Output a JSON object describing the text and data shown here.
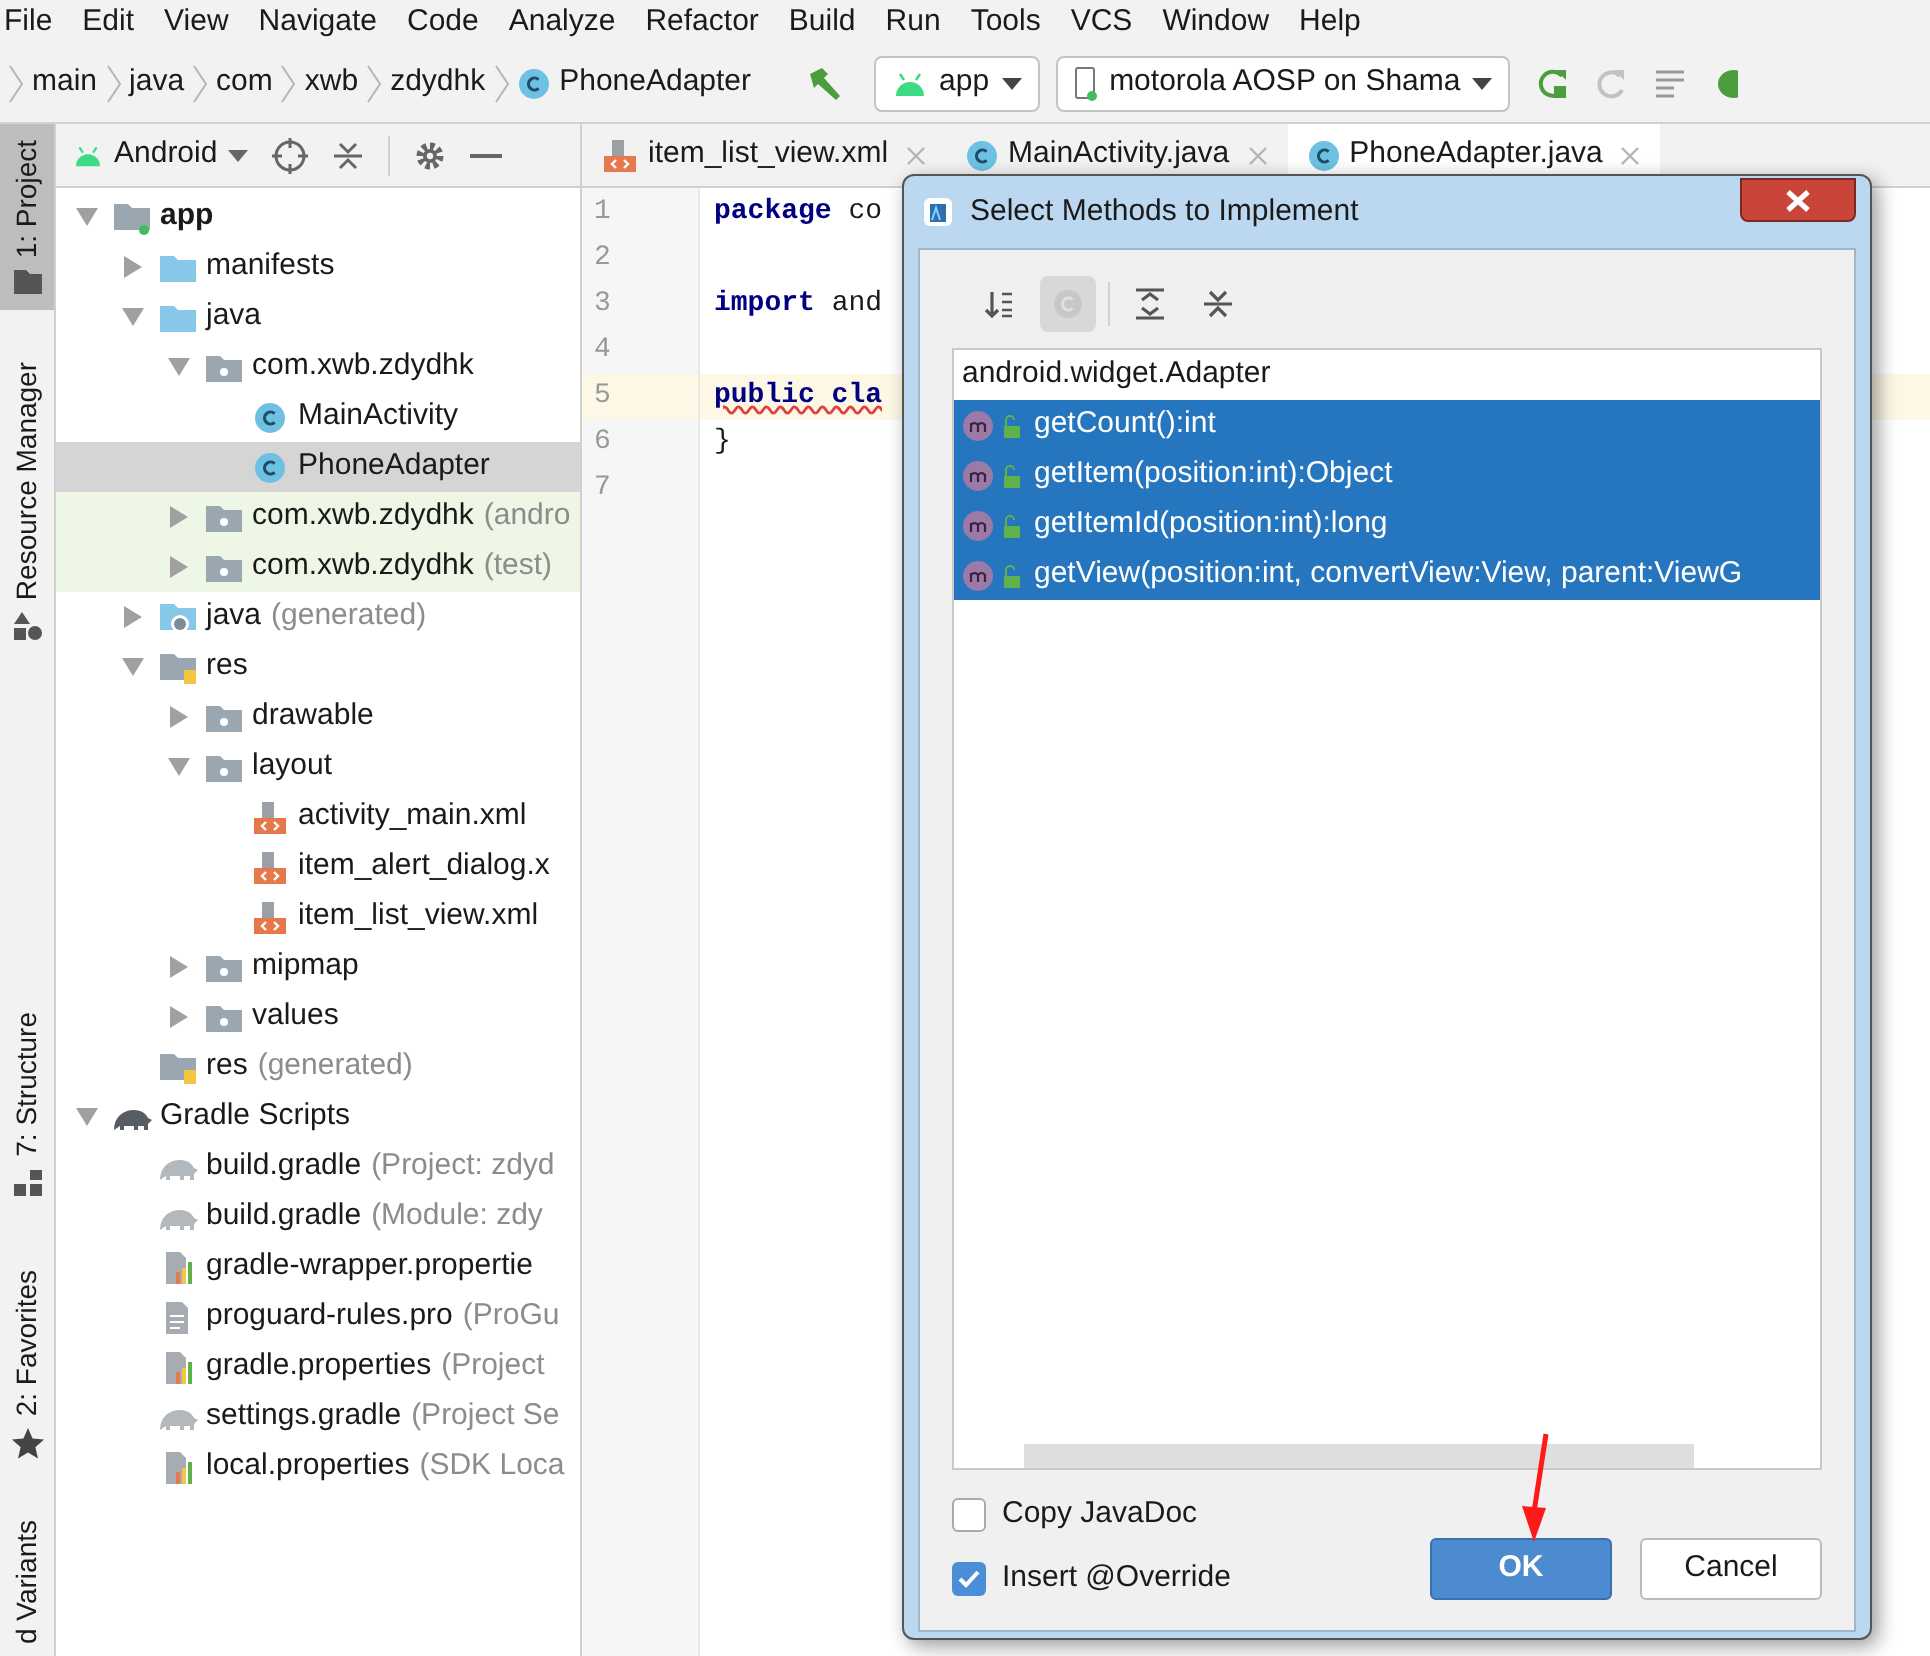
{
  "menu": [
    "File",
    "Edit",
    "View",
    "Navigate",
    "Code",
    "Analyze",
    "Refactor",
    "Build",
    "Run",
    "Tools",
    "VCS",
    "Window",
    "Help"
  ],
  "breadcrumb": [
    {
      "label": "main",
      "kind": "dir"
    },
    {
      "label": "java",
      "kind": "dir"
    },
    {
      "label": "com",
      "kind": "dir"
    },
    {
      "label": "xwb",
      "kind": "dir"
    },
    {
      "label": "zdydhk",
      "kind": "dir"
    },
    {
      "label": "PhoneAdapter",
      "kind": "class"
    }
  ],
  "run_config": "app",
  "device": "motorola AOSP on Shama",
  "side_tabs": [
    {
      "label": "1: Project",
      "selected": true,
      "kind": "folder"
    },
    {
      "label": "Resource Manager",
      "selected": false,
      "kind": "shapes"
    },
    {
      "label": "7: Structure",
      "selected": false,
      "kind": "blocks"
    },
    {
      "label": "2: Favorites",
      "selected": false,
      "kind": "star"
    },
    {
      "label": "d Variants",
      "selected": false,
      "kind": "none"
    }
  ],
  "project_view": "Android",
  "tree": [
    {
      "label": "app",
      "kind": "module",
      "expanded": true,
      "selected": false,
      "children": [
        {
          "label": "manifests",
          "kind": "folder",
          "expanded": false,
          "selected": false
        },
        {
          "label": "java",
          "kind": "folder",
          "expanded": true,
          "selected": false,
          "children": [
            {
              "label": "com.xwb.zdydhk",
              "kind": "package",
              "expanded": true,
              "selected": false,
              "children": [
                {
                  "label": "MainActivity",
                  "kind": "class",
                  "selected": false
                },
                {
                  "label": "PhoneAdapter",
                  "kind": "class",
                  "selected": true
                }
              ]
            },
            {
              "label": "com.xwb.zdydhk",
              "hint": "(andro",
              "kind": "package",
              "expanded": false,
              "selected": false,
              "tinted": true
            },
            {
              "label": "com.xwb.zdydhk",
              "hint": "(test)",
              "kind": "package",
              "expanded": false,
              "selected": false,
              "tinted": true
            }
          ]
        },
        {
          "label": "java",
          "hint": "(generated)",
          "kind": "gen-folder",
          "expanded": false,
          "selected": false
        },
        {
          "label": "res",
          "kind": "res-folder",
          "expanded": true,
          "selected": false,
          "children": [
            {
              "label": "drawable",
              "kind": "package",
              "expanded": false,
              "selected": false
            },
            {
              "label": "layout",
              "kind": "package",
              "expanded": true,
              "selected": false,
              "children": [
                {
                  "label": "activity_main.xml",
                  "kind": "xml",
                  "selected": false
                },
                {
                  "label": "item_alert_dialog.x",
                  "kind": "xml",
                  "selected": false
                },
                {
                  "label": "item_list_view.xml",
                  "kind": "xml",
                  "selected": false
                }
              ]
            },
            {
              "label": "mipmap",
              "kind": "package",
              "expanded": false,
              "selected": false
            },
            {
              "label": "values",
              "kind": "package",
              "expanded": false,
              "selected": false
            }
          ]
        },
        {
          "label": "res",
          "hint": "(generated)",
          "kind": "res-folder",
          "selected": false
        }
      ]
    },
    {
      "label": "Gradle Scripts",
      "kind": "gradle-root",
      "expanded": true,
      "selected": false,
      "children": [
        {
          "label": "build.gradle",
          "hint": "(Project: zdyd",
          "kind": "gradle",
          "selected": false
        },
        {
          "label": "build.gradle",
          "hint": "(Module: zdy",
          "kind": "gradle",
          "selected": false
        },
        {
          "label": "gradle-wrapper.propertie",
          "kind": "properties",
          "selected": false
        },
        {
          "label": "proguard-rules.pro",
          "hint": "(ProGu",
          "kind": "text",
          "selected": false
        },
        {
          "label": "gradle.properties",
          "hint": "(Project",
          "kind": "properties",
          "selected": false
        },
        {
          "label": "settings.gradle",
          "hint": "(Project Se",
          "kind": "gradle",
          "selected": false
        },
        {
          "label": "local.properties",
          "hint": "(SDK Loca",
          "kind": "properties",
          "selected": false
        }
      ]
    }
  ],
  "editor_tabs": [
    {
      "label": "item_list_view.xml",
      "kind": "xml",
      "selected": false
    },
    {
      "label": "MainActivity.java",
      "kind": "class",
      "selected": false
    },
    {
      "label": "PhoneAdapter.java",
      "kind": "class",
      "selected": true
    }
  ],
  "code": [
    {
      "number": "1",
      "current": false,
      "tokens": [
        {
          "text": "package",
          "kind": "keyword"
        },
        {
          "text": " co",
          "kind": "plain"
        }
      ]
    },
    {
      "number": "2",
      "current": false
    },
    {
      "number": "3",
      "current": false,
      "tokens": [
        {
          "text": "import",
          "kind": "keyword"
        },
        {
          "text": " and",
          "kind": "plain"
        }
      ]
    },
    {
      "number": "4",
      "current": false
    },
    {
      "number": "5",
      "current": true,
      "tokens": [
        {
          "text": "public cla",
          "kind": "keyword-error"
        }
      ]
    },
    {
      "number": "6",
      "current": false,
      "tokens": [
        {
          "text": "}",
          "kind": "plain"
        }
      ]
    },
    {
      "number": "7",
      "current": false
    }
  ],
  "dialog": {
    "title": "Select Methods to Implement",
    "toolbar": [
      {
        "kind": "sort-alpha",
        "selected": false
      },
      {
        "kind": "class-toggle",
        "selected": true
      },
      {
        "kind": "expand-all",
        "selected": false
      },
      {
        "kind": "collapse-all",
        "selected": false
      }
    ],
    "group": "android.widget.Adapter",
    "methods": [
      {
        "signature": "getCount():int",
        "selected": true
      },
      {
        "signature": "getItem(position:int):Object",
        "selected": true
      },
      {
        "signature": "getItemId(position:int):long",
        "selected": true
      },
      {
        "signature": "getView(position:int, convertView:View, parent:ViewG",
        "selected": true
      }
    ],
    "options": [
      {
        "label": "Copy JavaDoc",
        "checked": false
      },
      {
        "label": "Insert @Override",
        "checked": true
      }
    ],
    "buttons": [
      {
        "label": "OK",
        "kind": "primary"
      },
      {
        "label": "Cancel",
        "kind": "secondary"
      }
    ]
  }
}
